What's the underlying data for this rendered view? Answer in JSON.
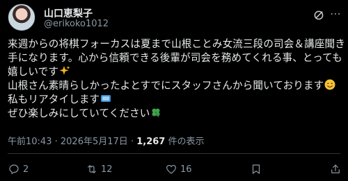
{
  "author": {
    "display_name": "山口恵梨子",
    "handle": "@erikoko1012"
  },
  "post": {
    "lines": [
      "来週からの将棋フォーカスは夏まで山根ことみ女流三段の司会＆講座聞き",
      "手になります。心から信頼できる後輩が司会を務めてくれる事、とっても",
      "嬉しいです",
      "山根さん素晴らしかったよとすでにスタッフさんから聞いております",
      "私もリアタイします",
      "ぜひ楽しみにしていてください"
    ]
  },
  "meta": {
    "time": "午前10:43",
    "separator": "·",
    "date": "2026年5月17日",
    "views_count": "1,267",
    "views_label": "件の表示"
  },
  "actions": {
    "replies": "2",
    "reposts": "12",
    "likes": "16"
  },
  "icons": {
    "menu": "more-icon",
    "grok": "grok-icon",
    "reply": "reply-icon",
    "repost": "repost-icon",
    "like": "heart-icon",
    "bookmark": "bookmark-icon",
    "share": "share-icon"
  }
}
